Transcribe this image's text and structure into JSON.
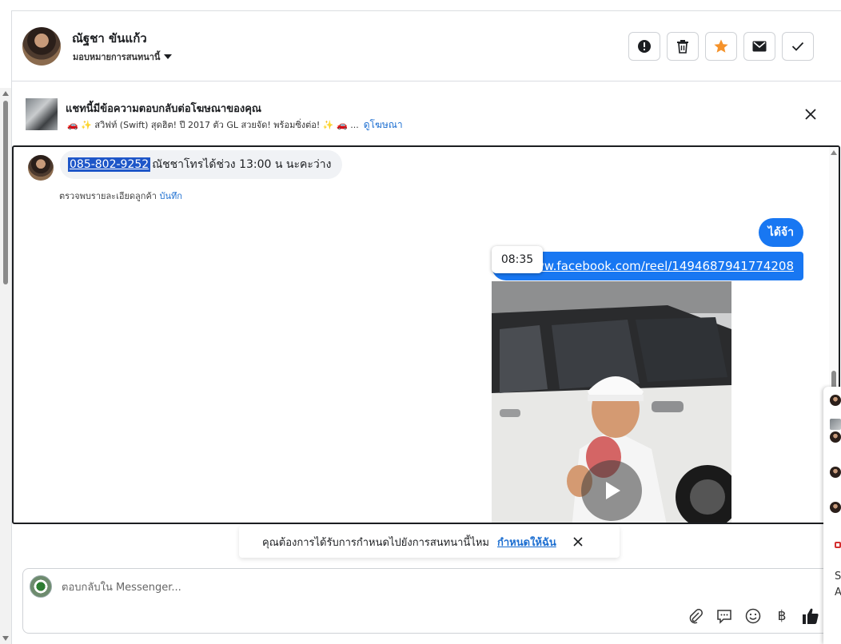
{
  "header": {
    "name": "ณัฐชา ขันแก้ว",
    "assign_label": "มอบหมายการสนทนานี้"
  },
  "ad": {
    "title": "แชทนี้มีข้อความตอบกลับต่อโฆษณาของคุณ",
    "subtitle": "🚗 ✨ สวิฟท์ (Swift) สุดฮิต! ปี 2017 ตัว GL สวยจัด! พร้อมซิ่งต่อ! ✨ 🚗 ...",
    "view_ad": "ดูโฆษณา"
  },
  "messages": {
    "incoming_phone": "085-802-9252",
    "incoming_text": "ณัชชาโทรได้ช่วง 13:00 น นะคะว่าง",
    "note_text": "ตรวจพบรายละเอียดลูกค้า",
    "note_link": "บันทึก",
    "outgoing_1": "ได้จ้า",
    "outgoing_2": "https://www.facebook.com/reel/1494687941774208",
    "time_tooltip": "08:35"
  },
  "toast": {
    "text": "คุณต้องการได้รับการกำหนดไปยังการสนทนานี้ไหม",
    "link": "กำหนดให้ฉัน"
  },
  "composer": {
    "placeholder": "ตอบกลับใน Messenger..."
  },
  "edge_panel": {
    "text_1": "S",
    "text_2": "A"
  },
  "colors": {
    "accent": "#1877f2",
    "star": "#f5922a",
    "link": "#1d6fd1"
  }
}
